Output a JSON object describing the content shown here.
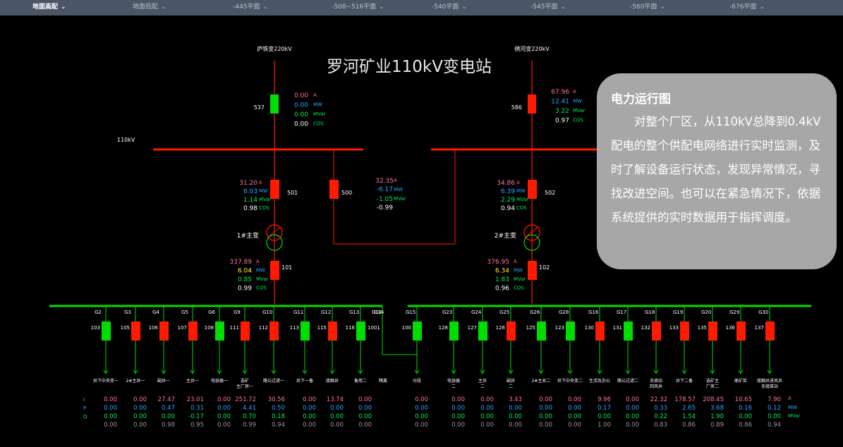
{
  "tabs": [
    {
      "label": "地面高配",
      "active": true
    },
    {
      "label": "地面低配",
      "active": false
    },
    {
      "label": "-445平面",
      "active": false
    },
    {
      "label": "-508~516平面",
      "active": false
    },
    {
      "label": "-540平面",
      "active": false
    },
    {
      "label": "-545平面",
      "active": false
    },
    {
      "label": "-560平面",
      "active": false
    },
    {
      "label": "-676平面",
      "active": false
    }
  ],
  "title": "罗河矿业110kV变电站",
  "bus_label": "110kV",
  "colors": {
    "on": "#00dd00",
    "off": "#ff1a00",
    "current": "#ff6fa3",
    "power": "#22a9ff",
    "reactive": "#00ee55",
    "factor": "#ffffff",
    "highlight": "#ffee33"
  },
  "incoming": [
    {
      "source": "庐铁变220kV",
      "breaker": "537",
      "state": "on",
      "I": "0.00",
      "P": "0.00",
      "Q": "0.00",
      "cos": "0.00"
    },
    {
      "source": "绣河变220kV",
      "breaker": "586",
      "state": "off",
      "I": "67.96",
      "P": "12.41",
      "Q": "3.22",
      "cos": "0.97"
    }
  ],
  "units": {
    "I": "A",
    "P": "MW",
    "Q": "MVar",
    "cos": "COS"
  },
  "hv_breakers": [
    {
      "id": "501",
      "I": "31.20",
      "P": "6.03",
      "Q": "1.14",
      "cos": "0.98"
    },
    {
      "id": "502",
      "I": "34.86",
      "P": "6.39",
      "Q": "2.29",
      "cos": "0.94"
    }
  ],
  "tie": {
    "id": "500",
    "I": "32.35",
    "P": "-6.17",
    "Q": "-1.05",
    "cos": "-0.99"
  },
  "transformers": [
    {
      "label": "1#主变"
    },
    {
      "label": "2#主变"
    }
  ],
  "lv_breakers": [
    {
      "id": "101",
      "I": "337.89",
      "P": "6.04",
      "Q": "0.85",
      "cos": "0.99"
    },
    {
      "id": "102",
      "I": "376.95",
      "P": "6.34",
      "Q": "1.83",
      "cos": "0.96"
    }
  ],
  "row_labels": [
    "I",
    "P",
    "Q"
  ],
  "feeders_left": [
    {
      "g": "G2",
      "id": "103",
      "state": "on",
      "name": [
        "井下中央变一"
      ],
      "I": "0.00",
      "P": "0.00",
      "Q": "0.00",
      "cos": "0.00"
    },
    {
      "g": "G3",
      "id": "105",
      "state": "off",
      "name": [
        "2#主井一"
      ],
      "I": "0.00",
      "P": "0.00",
      "Q": "0.00",
      "cos": "0.00"
    },
    {
      "g": "G4",
      "id": "106",
      "state": "off",
      "name": [
        "副井一"
      ],
      "I": "27.47",
      "P": "0.47",
      "Q": "0.00",
      "cos": "0.98"
    },
    {
      "g": "G5",
      "id": "107",
      "state": "off",
      "name": [
        "主井一"
      ],
      "I": "23.01",
      "P": "0.31",
      "Q": "-0.17",
      "cos": "0.95"
    },
    {
      "g": "G6",
      "id": "108",
      "state": "on",
      "name": [
        "电容器一"
      ],
      "I": "0.00",
      "P": "0.00",
      "Q": "0.00",
      "cos": "0.00"
    },
    {
      "g": "G9",
      "id": "111",
      "state": "off",
      "name": [
        "选矿",
        "主厂房一"
      ],
      "I": "251.72",
      "P": "4.41",
      "Q": "0.70",
      "cos": "0.99"
    },
    {
      "g": "G10",
      "id": "112",
      "state": "off",
      "name": [
        "路公过滤一"
      ],
      "I": "30.56",
      "P": "0.50",
      "Q": "0.18",
      "cos": "0.94"
    },
    {
      "g": "G11",
      "id": "113",
      "state": "on",
      "name": [
        "井下一备"
      ],
      "I": "0.00",
      "P": "0.00",
      "Q": "0.00",
      "cos": "0.00"
    },
    {
      "g": "G12",
      "id": "115",
      "state": "off",
      "name": [
        "接触井"
      ],
      "I": "13.74",
      "P": "0.00",
      "Q": "0.00",
      "cos": "0.00"
    },
    {
      "g": "G13",
      "id": "116",
      "state": "on",
      "name": [
        "备用二"
      ],
      "I": "0.00",
      "P": "0.00",
      "Q": "0.00",
      "cos": "0.00"
    },
    {
      "g": "G14",
      "id": "1001",
      "state": "none",
      "name": [
        "隔离"
      ],
      "I": "",
      "P": "",
      "Q": "",
      "cos": ""
    }
  ],
  "feeders_right": [
    {
      "g": "G15",
      "id": "100",
      "state": "on",
      "name": [
        "分段"
      ],
      "I": "0.00",
      "P": "0.00",
      "Q": "0.00",
      "cos": "0.00"
    },
    {
      "g": "G23",
      "id": "128",
      "state": "on",
      "name": [
        "电容器",
        "二"
      ],
      "I": "0.00",
      "P": "0.00",
      "Q": "0.00",
      "cos": "0.00"
    },
    {
      "g": "G24",
      "id": "127",
      "state": "on",
      "name": [
        "主井",
        "二"
      ],
      "I": "0.00",
      "P": "0.00",
      "Q": "0.00",
      "cos": "0.00"
    },
    {
      "g": "G25",
      "id": "126",
      "state": "off",
      "name": [
        "副井",
        "二"
      ],
      "I": "3.43",
      "P": "0.00",
      "Q": "0.00",
      "cos": "0.00"
    },
    {
      "g": "G26",
      "id": "125",
      "state": "on",
      "name": [
        "2#主井二"
      ],
      "I": "0.00",
      "P": "0.00",
      "Q": "0.00",
      "cos": "0.00"
    },
    {
      "g": "G28",
      "id": "123",
      "state": "on",
      "name": [
        "井下中央变二"
      ],
      "I": "0.00",
      "P": "0.00",
      "Q": "0.00",
      "cos": "0.00"
    },
    {
      "g": "G16",
      "id": "130",
      "state": "off",
      "name": [
        "生活及办公"
      ],
      "I": "9.96",
      "P": "0.17",
      "Q": "0.00",
      "cos": "1.00"
    },
    {
      "g": "G17",
      "id": "131",
      "state": "on",
      "name": [
        "路公过滤二"
      ],
      "I": "0.00",
      "P": "0.00",
      "Q": "0.00",
      "cos": "0.00"
    },
    {
      "g": "G18",
      "id": "132",
      "state": "off",
      "name": [
        "充填站",
        "回风井"
      ],
      "I": "22.32",
      "P": "0.33",
      "Q": "0.22",
      "cos": "0.83"
    },
    {
      "g": "G19",
      "id": "133",
      "state": "off",
      "name": [
        "井下二备"
      ],
      "I": "178.57",
      "P": "2.65",
      "Q": "1.54",
      "cos": "0.86"
    },
    {
      "g": "G20",
      "id": "135",
      "state": "off",
      "name": [
        "选矿主",
        "厂房二"
      ],
      "I": "208.45",
      "P": "3.68",
      "Q": "1.90",
      "cos": "0.89"
    },
    {
      "g": "G29",
      "id": "136",
      "state": "off",
      "name": [
        "尾矿库"
      ],
      "I": "10.65",
      "P": "0.16",
      "Q": "0.00",
      "cos": "0.86"
    },
    {
      "g": "G30",
      "id": "137",
      "state": "off",
      "name": [
        "接触井进风井",
        "充填泵站"
      ],
      "I": "7.90",
      "P": "0.12",
      "Q": "0.00",
      "cos": "0.94"
    }
  ],
  "info": {
    "title": "电力运行图",
    "body": "对整个厂区，从110kV总降到0.4kV配电的整个供配电网络进行实时监测，及时了解设备运行状态，发现异常情况，寻找改进空间。也可以在紧急情况下，依据系统提供的实时数据用于指挥调度。"
  }
}
